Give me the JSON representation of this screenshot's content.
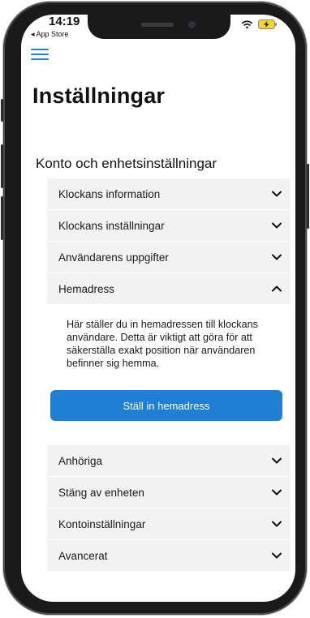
{
  "status_bar": {
    "time": "14:19",
    "back_app": "◂ App Store"
  },
  "header": {
    "menu_icon": "hamburger-icon",
    "title": "Inställningar"
  },
  "section": {
    "title": "Konto och enhetsinställningar"
  },
  "accordion_top": [
    {
      "label": "Klockans information",
      "expanded": false
    },
    {
      "label": "Klockans inställningar",
      "expanded": false
    },
    {
      "label": "Användarens uppgifter",
      "expanded": false
    },
    {
      "label": "Hemadress",
      "expanded": true
    }
  ],
  "hemadress": {
    "description": "Här ställer du in hemadressen till klockans användare. Detta är viktigt att göra för att säkerställa exakt position när användaren befinner sig hemma.",
    "button_label": "Ställ in hemadress"
  },
  "accordion_bottom": [
    {
      "label": "Anhöriga",
      "expanded": false
    },
    {
      "label": "Stäng av enheten",
      "expanded": false
    },
    {
      "label": "Kontoinställningar",
      "expanded": false
    },
    {
      "label": "Avancerat",
      "expanded": false
    }
  ],
  "colors": {
    "accent": "#1f7fd3",
    "row_bg": "#f2f2f2",
    "text": "#1a1a1a"
  }
}
